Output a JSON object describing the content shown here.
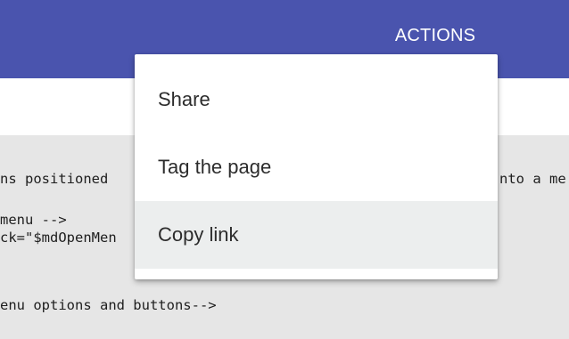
{
  "toolbar": {
    "actions_label": "ACTIONS",
    "background_color": "#4a54ae"
  },
  "code": {
    "line1_left": "ns positioned",
    "line1_right": "nto a me",
    "line2": "menu -->",
    "line3": "ck=\"$mdOpenMen",
    "line4": "enu options and buttons-->"
  },
  "menu": {
    "items": [
      {
        "label": "Share",
        "highlighted": false
      },
      {
        "label": "Tag the page",
        "highlighted": false
      },
      {
        "label": "Copy link",
        "highlighted": true
      }
    ],
    "highlight_color": "#eceeee"
  }
}
